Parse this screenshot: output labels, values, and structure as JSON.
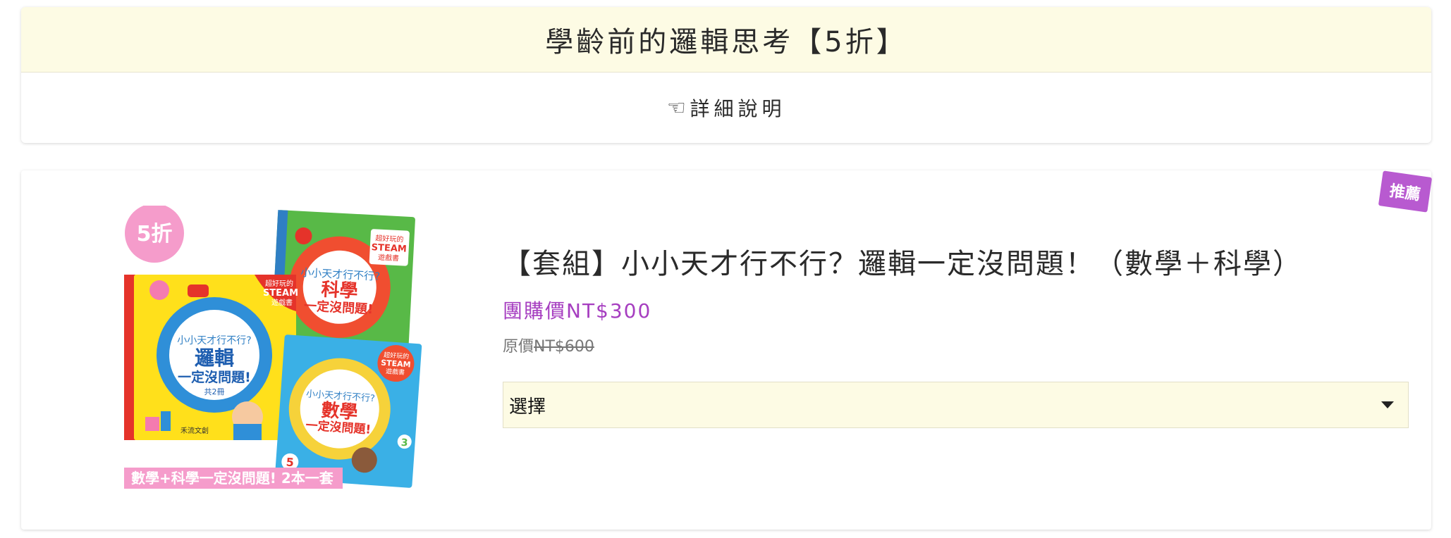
{
  "header": {
    "title": "學齡前的邏輯思考【5折】",
    "detail_icon": "pointing-hand-icon",
    "detail_label": "詳細說明"
  },
  "product": {
    "ribbon_label": "推薦",
    "image": {
      "discount_badge": "5折",
      "caption": "數學+科學一定沒問題! 2本一套",
      "book_series": "小小天才行不行?",
      "book1_title": "邏輯",
      "book1_subtitle": "一定沒問題!",
      "book1_count": "共2冊",
      "book2_title": "科學",
      "book2_subtitle": "一定沒問題!",
      "book3_title": "數學",
      "book3_subtitle": "一定沒問題!",
      "steam_tag_line1": "超好玩的",
      "steam_tag_line2": "STEAM",
      "steam_tag_line3": "遊戲書",
      "publisher": "禾流文創"
    },
    "title": "【套組】小小天才行不行？邏輯一定沒問題！（數學＋科學）",
    "group_price_label": "團購價NT$300",
    "original_price_prefix": "原價",
    "original_price_value": "NT$600",
    "select": {
      "value": "選擇",
      "caret_icon": "caret-down-icon"
    }
  },
  "colors": {
    "header_bg": "#fdfbe4",
    "accent_purple": "#a63ec0",
    "ribbon": "#b85ad0",
    "badge_pink": "#f59ccb"
  }
}
